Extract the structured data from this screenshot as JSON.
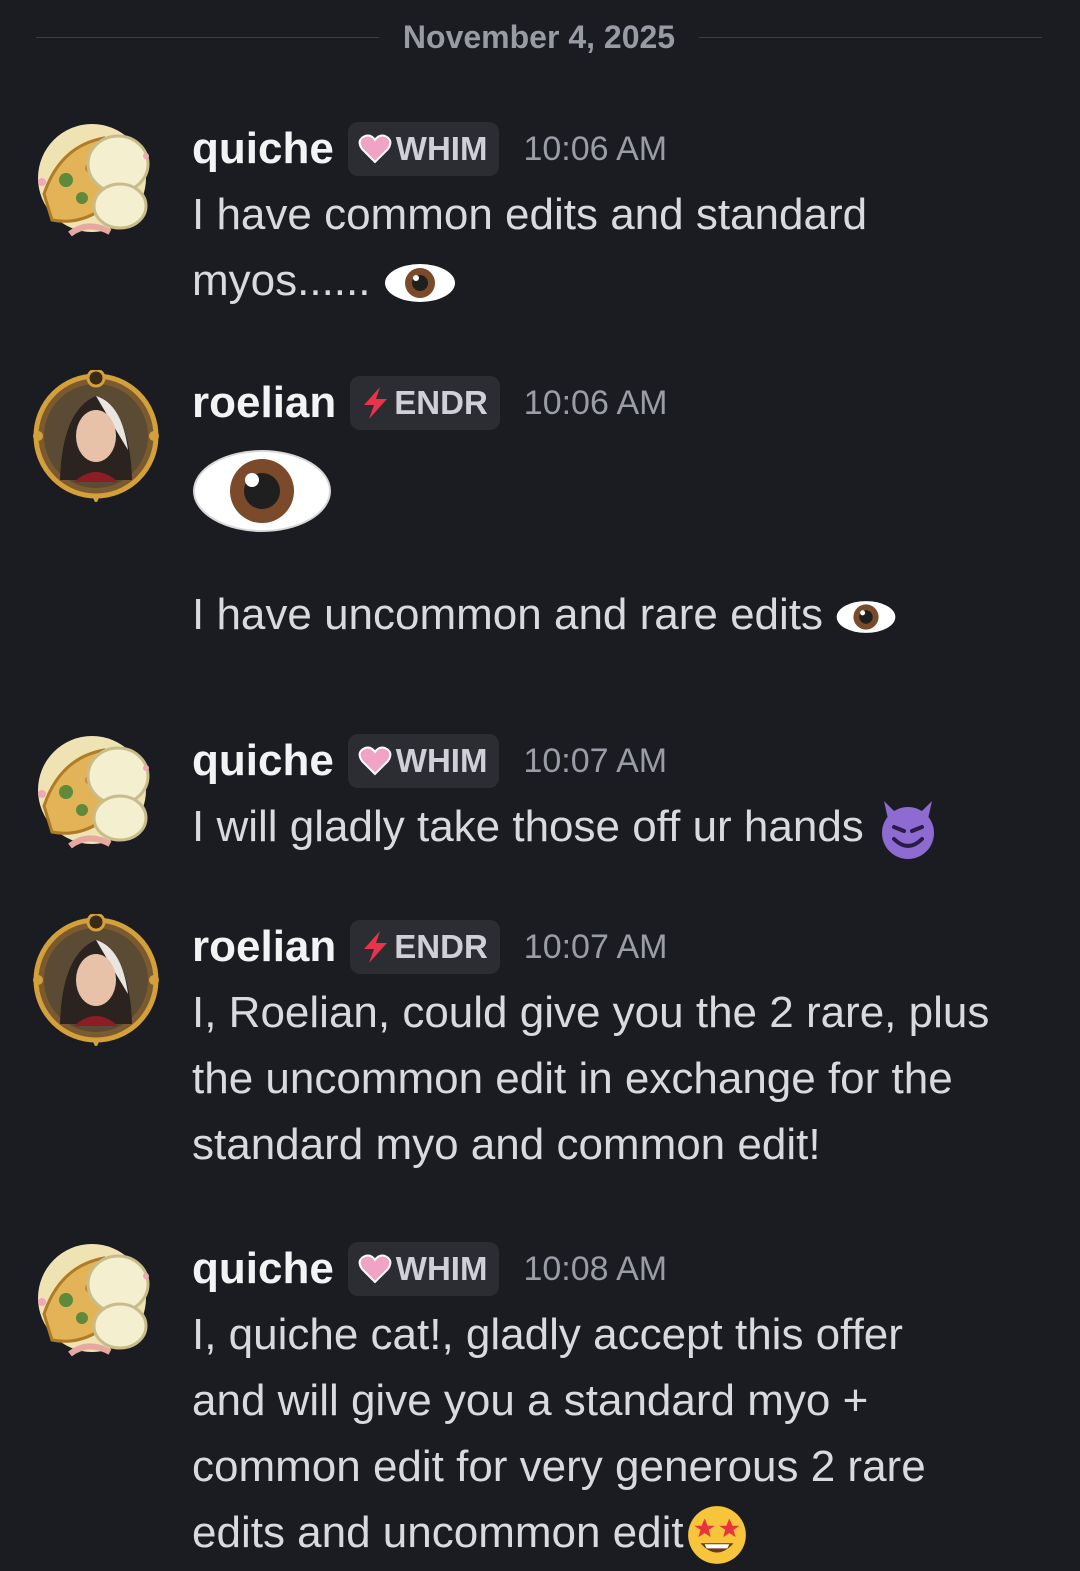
{
  "date_divider": "November 4, 2025",
  "users": {
    "quiche": {
      "name": "quiche",
      "tag": "WHIM",
      "tag_icon": "heart-icon",
      "tag_color": "#f0a3c4"
    },
    "roelian": {
      "name": "roelian",
      "tag": "ENDR",
      "tag_icon": "lightning-icon",
      "tag_color": "#e8334a"
    }
  },
  "messages": [
    {
      "author": "quiche",
      "time": "10:06 AM",
      "lines": [
        "I have common edits and standard",
        "myos......"
      ],
      "trailing_emoji": "eye-icon"
    },
    {
      "author": "roelian",
      "time": "10:06 AM",
      "big_emoji": "eye-icon",
      "lines": [
        "I have uncommon and rare edits"
      ],
      "trailing_emoji": "eye-icon"
    },
    {
      "author": "quiche",
      "time": "10:07 AM",
      "lines": [
        "I will gladly take those off ur hands"
      ],
      "trailing_emoji": "smiling-devil-icon"
    },
    {
      "author": "roelian",
      "time": "10:07 AM",
      "lines": [
        "I, Roelian, could give you the 2 rare, plus",
        "the uncommon edit in exchange for the",
        "standard myo and common edit!"
      ]
    },
    {
      "author": "quiche",
      "time": "10:08 AM",
      "lines": [
        "I, quiche cat!, gladly accept this offer",
        "and will give you a standard myo +",
        "common edit for very generous 2 rare",
        "edits and uncommon edit"
      ],
      "trailing_emoji": "star-struck-icon"
    }
  ]
}
